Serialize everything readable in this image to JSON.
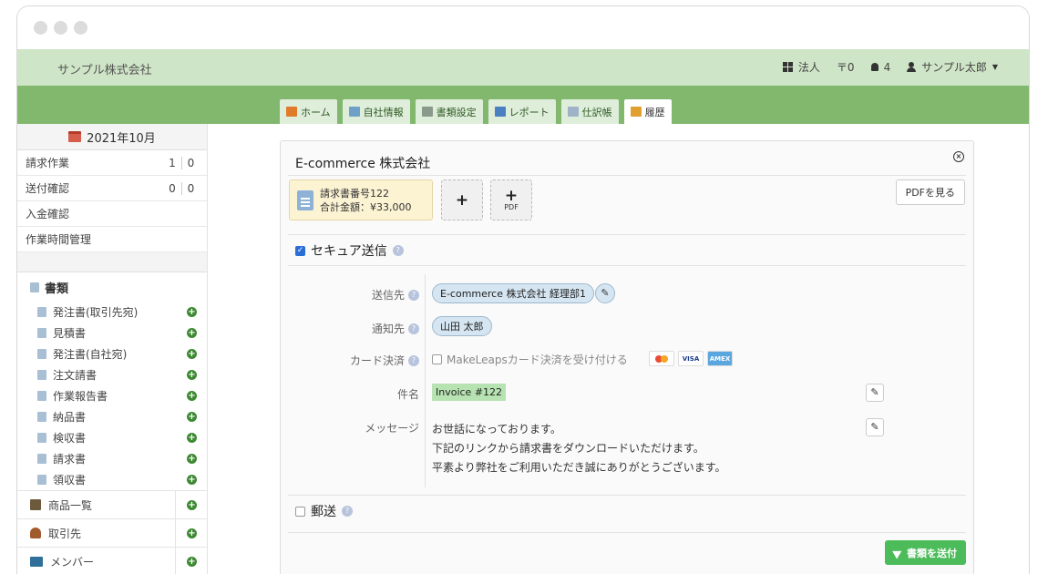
{
  "header": {
    "company": "サンプル株式会社",
    "corp_label": "法人",
    "filter_count": "〒0",
    "notif_count": "4",
    "user_name": "サンプル太郎"
  },
  "tabs": [
    {
      "label": "ホーム",
      "icon": "house-icon",
      "color": "#e07b2a"
    },
    {
      "label": "自社情報",
      "icon": "building-icon",
      "color": "#6fa0c8"
    },
    {
      "label": "書類設定",
      "icon": "gear-icon",
      "color": "#8a9a8a"
    },
    {
      "label": "レポート",
      "icon": "bar-chart-icon",
      "color": "#4a7fc0"
    },
    {
      "label": "仕訳帳",
      "icon": "ledger-icon",
      "color": "#9fb3c8"
    },
    {
      "label": "履歴",
      "icon": "history-icon",
      "color": "#e0a030",
      "active": true
    }
  ],
  "sidebar": {
    "month": "2021年10月",
    "work_items": [
      {
        "label": "請求作業",
        "a": "1",
        "b": "0"
      },
      {
        "label": "送付確認",
        "a": "0",
        "b": "0"
      },
      {
        "label": "入金確認"
      },
      {
        "label": "作業時間管理"
      }
    ],
    "docs_heading": "書類",
    "doc_items": [
      "発注書(取引先宛)",
      "見積書",
      "発注書(自社宛)",
      "注文請書",
      "作業報告書",
      "納品書",
      "検収書",
      "請求書",
      "領収書"
    ],
    "bottom_items": [
      {
        "label": "商品一覧",
        "icon": "products-icon"
      },
      {
        "label": "取引先",
        "icon": "person-icon"
      },
      {
        "label": "メンバー",
        "icon": "members-icon"
      }
    ]
  },
  "panel": {
    "title": "E-commerce 株式会社",
    "invoice_number": "請求書番号122",
    "invoice_total": "合計金額：¥33,000",
    "add_label": "+",
    "add_pdf_label": "PDF",
    "pdf_button": "PDFを見る",
    "secure_send": "セキュア送信",
    "recipient_label": "送信先",
    "recipient": "E-commerce 株式会社 経理部1",
    "notify_label": "通知先",
    "notify": "山田 太郎",
    "card_label": "カード決済",
    "card_option": "MakeLeapsカード決済を受け付ける",
    "card_visa": "VISA",
    "card_amex": "AMEX",
    "subject_label": "件名",
    "subject": "Invoice #122",
    "message_label": "メッセージ",
    "message_lines": [
      "お世話になっております。",
      "下記のリンクから請求書をダウンロードいただけます。",
      "平素より弊社をご利用いただき誠にありがとうございます。"
    ],
    "postal": "郵送",
    "send_button": "書類を送付"
  }
}
